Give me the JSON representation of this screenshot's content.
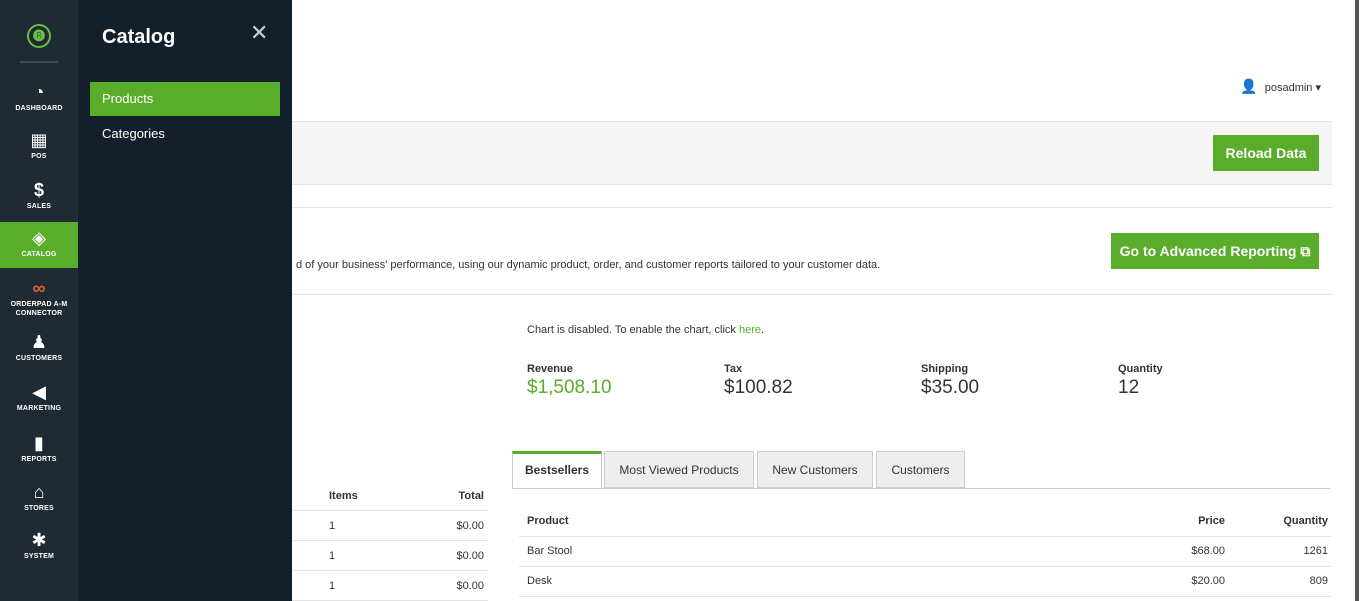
{
  "sidebar": {
    "logo_glyph": "🅑",
    "items": [
      {
        "icon": "dashboard-icon",
        "glyph": "◔",
        "label": "DASHBOARD"
      },
      {
        "icon": "pos-icon",
        "glyph": "▦",
        "label": "POS"
      },
      {
        "icon": "dollar-icon",
        "glyph": "$",
        "label": "SALES"
      },
      {
        "icon": "box-icon",
        "glyph": "◈",
        "label": "CATALOG"
      },
      {
        "icon": "connector-icon",
        "glyph": "∞",
        "label": "ORDERPAD A-M CONNECTOR"
      },
      {
        "icon": "person-icon",
        "glyph": "♟",
        "label": "CUSTOMERS"
      },
      {
        "icon": "megaphone-icon",
        "glyph": "◀",
        "label": "MARKETING"
      },
      {
        "icon": "bar-chart-icon",
        "glyph": "▮",
        "label": "REPORTS"
      },
      {
        "icon": "store-icon",
        "glyph": "⌂",
        "label": "STORES"
      },
      {
        "icon": "gear-icon",
        "glyph": "✱",
        "label": "SYSTEM"
      }
    ]
  },
  "flyout": {
    "title": "Catalog",
    "close_glyph": "✕",
    "items": [
      "Products",
      "Categories"
    ]
  },
  "header": {
    "user_glyph": "👤",
    "username": "posadmin ▾"
  },
  "actions": {
    "reload": "Reload Data",
    "advanced": "Go to Advanced Reporting ⧉"
  },
  "intro_text": "d of your business' performance, using our dynamic product, order, and customer reports tailored to your customer data.",
  "chart_note": {
    "text": "Chart is disabled. To enable the chart, click ",
    "link": "here",
    "suffix": "."
  },
  "stats": [
    {
      "label": "Revenue",
      "value": "$1,508.10"
    },
    {
      "label": "Tax",
      "value": "$100.82"
    },
    {
      "label": "Shipping",
      "value": "$35.00"
    },
    {
      "label": "Quantity",
      "value": "12"
    }
  ],
  "left_table": {
    "headers": [
      "Items",
      "Total"
    ],
    "rows": [
      [
        "1",
        "$0.00"
      ],
      [
        "1",
        "$0.00"
      ],
      [
        "1",
        "$0.00"
      ]
    ]
  },
  "tabs": [
    "Bestsellers",
    "Most Viewed Products",
    "New Customers",
    "Customers"
  ],
  "bestsellers": {
    "headers": [
      "Product",
      "Price",
      "Quantity"
    ],
    "rows": [
      [
        "Bar Stool",
        "$68.00",
        "1261"
      ],
      [
        "Desk",
        "$20.00",
        "809"
      ]
    ]
  },
  "colors": {
    "accent": "#5aad2a",
    "sidebar": "#1f2a33",
    "flyout": "#13202b"
  }
}
